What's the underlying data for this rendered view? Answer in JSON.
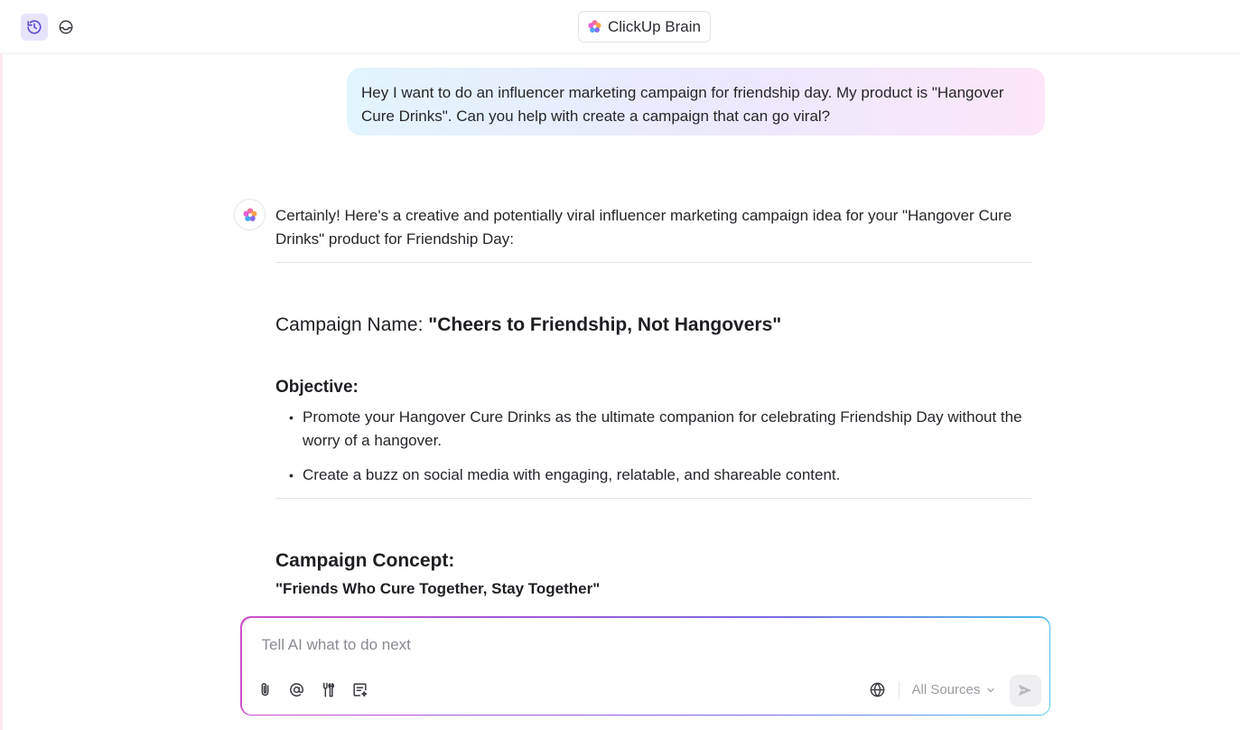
{
  "header": {
    "title": "ClickUp Brain",
    "history_icon": "history-icon",
    "inbox_icon": "inbox-icon"
  },
  "conversation": {
    "user_message": "Hey I want to do an influencer marketing campaign for friendship day. My product is \"Hangover Cure Drinks\". Can you help with create a campaign that can go viral?",
    "ai_intro": "Certainly! Here's a creative and potentially viral influencer marketing campaign idea for your \"Hangover Cure Drinks\" product for Friendship Day:",
    "campaign_name_label": "Campaign Name: ",
    "campaign_name_value": "\"Cheers to Friendship, Not Hangovers\"",
    "objective_heading": "Objective:",
    "objectives": [
      "Promote your Hangover Cure Drinks as the ultimate companion for celebrating Friendship Day without the worry of a hangover.",
      "Create a buzz on social media with engaging, relatable, and shareable content."
    ],
    "concept_heading": "Campaign Concept:",
    "concept_tagline": "\"Friends Who Cure Together, Stay Together\""
  },
  "composer": {
    "placeholder": "Tell AI what to do next",
    "value": "",
    "sources_label": "All Sources",
    "tools": [
      "attach-icon",
      "mention-icon",
      "tools-icon",
      "note-sparkle-icon"
    ]
  },
  "colors": {
    "accent": "#6b5ce7",
    "history_bg": "#e6e4fb",
    "bubble_start": "#e2f4fd",
    "bubble_end": "#fce6f8"
  }
}
